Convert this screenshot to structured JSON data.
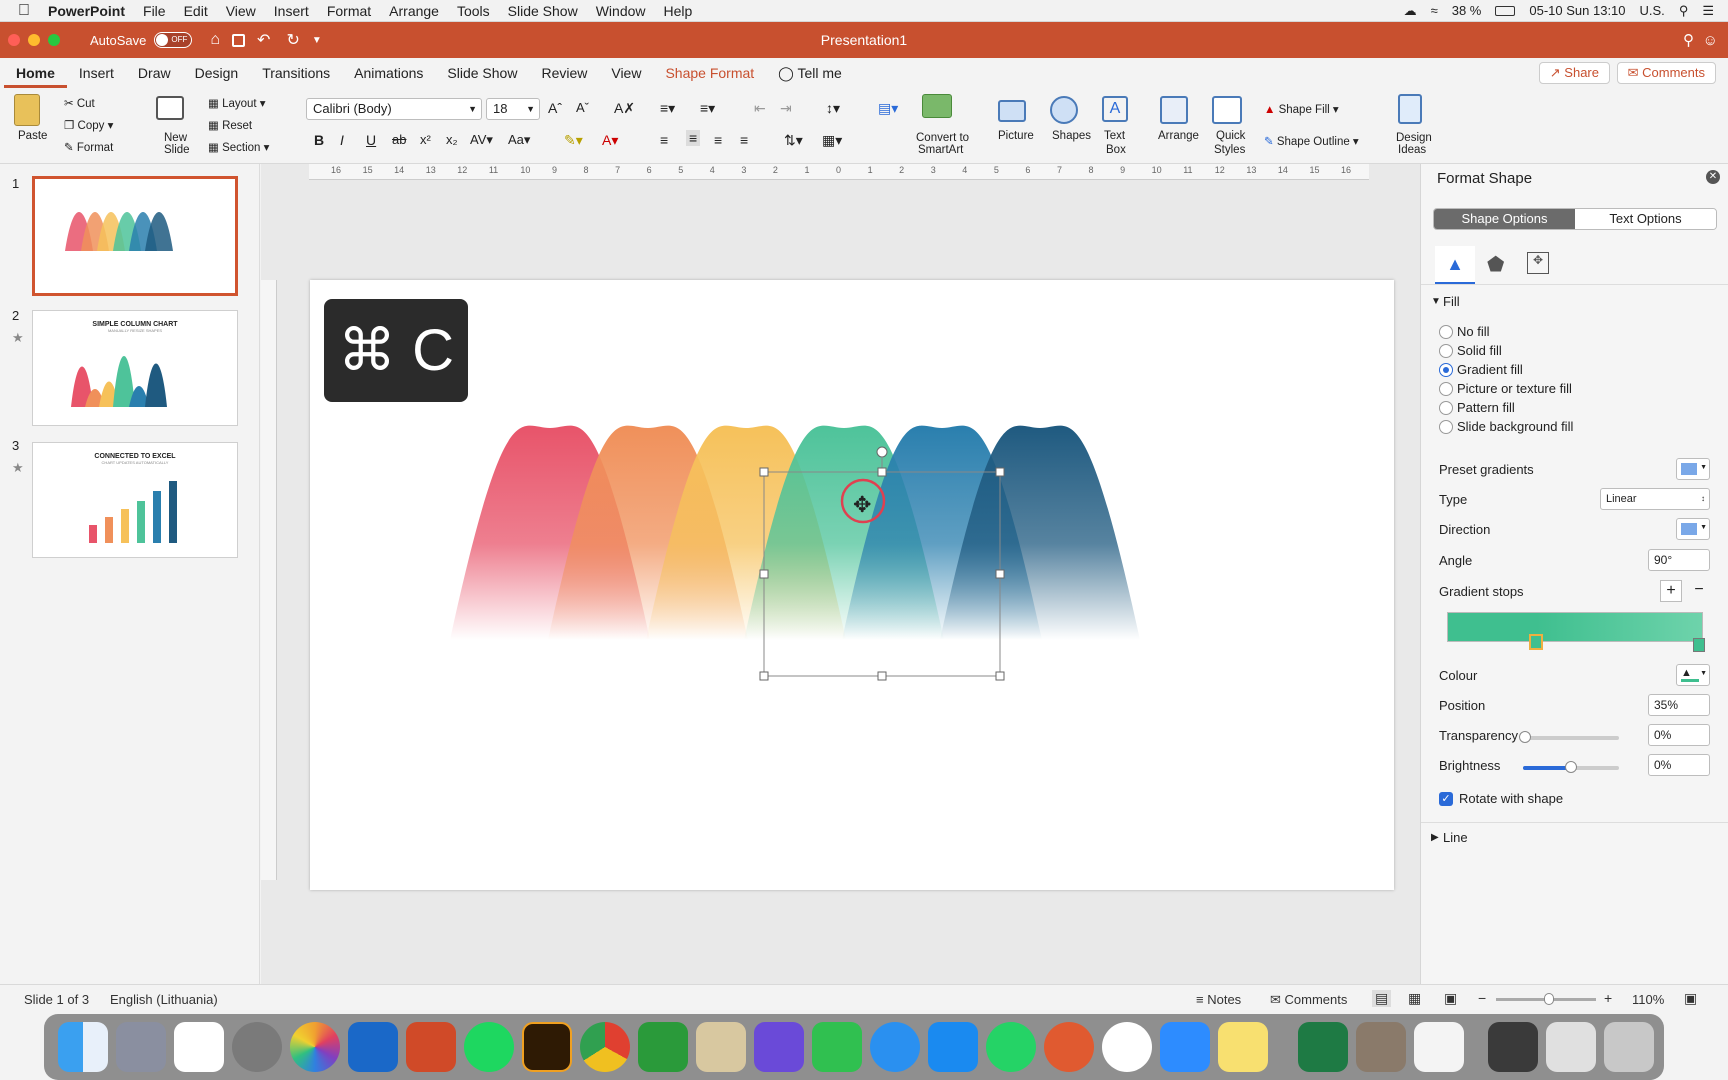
{
  "menubar": {
    "app": "PowerPoint",
    "items": [
      "File",
      "Edit",
      "View",
      "Insert",
      "Format",
      "Arrange",
      "Tools",
      "Slide Show",
      "Window",
      "Help"
    ],
    "battery": "38 %",
    "datetime": "05-10 Sun  13:10",
    "input_source": "U.S."
  },
  "titlebar": {
    "autosave": "AutoSave",
    "autosave_state": "OFF",
    "title": "Presentation1"
  },
  "tabs": [
    "Home",
    "Insert",
    "Draw",
    "Design",
    "Transitions",
    "Animations",
    "Slide Show",
    "Review",
    "View",
    "Shape Format"
  ],
  "tell_me": "Tell me",
  "share": "Share",
  "comments_btn": "Comments",
  "ribbon": {
    "paste": "Paste",
    "cut": "Cut",
    "copy": "Copy",
    "format": "Format",
    "new_slide": [
      "New",
      "Slide"
    ],
    "layout": "Layout",
    "reset": "Reset",
    "section": "Section",
    "font": "Calibri (Body)",
    "size": "18",
    "convert": [
      "Convert to",
      "SmartArt"
    ],
    "picture": "Picture",
    "shapes": "Shapes",
    "textbox": [
      "Text",
      "Box"
    ],
    "arrange": "Arrange",
    "quick_styles": [
      "Quick",
      "Styles"
    ],
    "shape_fill": "Shape Fill",
    "shape_outline": "Shape Outline",
    "design_ideas": [
      "Design",
      "Ideas"
    ]
  },
  "ruler_labels": [
    "16",
    "15",
    "14",
    "13",
    "12",
    "11",
    "10",
    "9",
    "8",
    "7",
    "6",
    "5",
    "4",
    "3",
    "2",
    "1",
    "0",
    "1",
    "2",
    "3",
    "4",
    "5",
    "6",
    "7",
    "8",
    "9",
    "10",
    "11",
    "12",
    "13",
    "14",
    "15",
    "16"
  ],
  "slides": [
    {
      "num": "1"
    },
    {
      "num": "2",
      "title": "SIMPLE COLUMN CHART",
      "subtitle": "MANUALLY RESIZE SHAPES"
    },
    {
      "num": "3",
      "title": "CONNECTED TO EXCEL",
      "subtitle": "CHART UPDATES AUTOMATICALLY"
    }
  ],
  "shortcut": "⌘ C",
  "panel": {
    "title": "Format Shape",
    "shape_options": "Shape Options",
    "text_options": "Text Options",
    "fill_header": "Fill",
    "fill_options": [
      "No fill",
      "Solid fill",
      "Gradient fill",
      "Picture or texture fill",
      "Pattern fill",
      "Slide background fill"
    ],
    "selected_fill": 2,
    "preset": "Preset gradients",
    "type_label": "Type",
    "type_value": "Linear",
    "direction": "Direction",
    "angle_label": "Angle",
    "angle_value": "90°",
    "stops_label": "Gradient stops",
    "colour": "Colour",
    "position_label": "Position",
    "position_value": "35%",
    "transparency_label": "Transparency",
    "transparency_value": "0%",
    "brightness_label": "Brightness",
    "brightness_value": "0%",
    "rotate": "Rotate with shape",
    "line_header": "Line",
    "stop_color": "#3fbf8f"
  },
  "status": {
    "slide": "Slide 1 of 3",
    "language": "English (Lithuania)",
    "notes": "Notes",
    "comments": "Comments",
    "zoom": "110%"
  },
  "hills": [
    {
      "color": "#e8546a"
    },
    {
      "color": "#f0905a"
    },
    {
      "color": "#f6c15a"
    },
    {
      "color": "#4ec39a"
    },
    {
      "color": "#2a7fae"
    },
    {
      "color": "#1f5a80"
    }
  ]
}
